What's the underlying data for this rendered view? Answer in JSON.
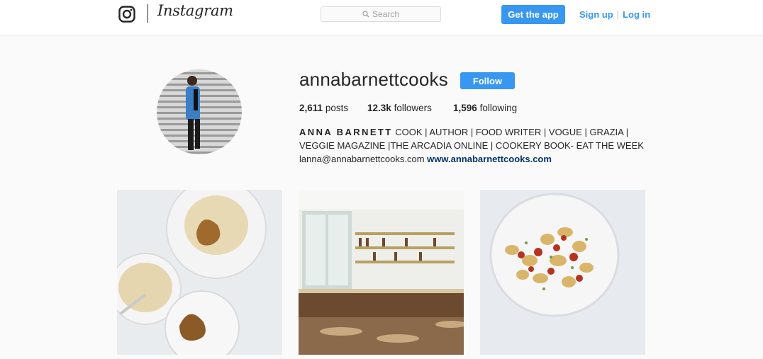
{
  "nav": {
    "wordmark": "Instagram",
    "search_placeholder": "Search",
    "get_app_label": "Get the app",
    "sign_up_label": "Sign up",
    "separator": "|",
    "log_in_label": "Log in"
  },
  "profile": {
    "username": "annabarnettcooks",
    "follow_label": "Follow",
    "stats": {
      "posts_count": "2,611",
      "posts_label": "posts",
      "followers_count": "12.3k",
      "followers_label": "followers",
      "following_count": "1,596",
      "following_label": "following"
    },
    "bio": {
      "name": "ANNA BARNETT",
      "line1_rest": " COOK | AUTHOR | FOOD WRITER | VOGUE | GRAZIA |",
      "line2": "VEGGIE MAGAZINE |THE ARCADIA ONLINE | COOKERY BOOK- EAT THE WEEK",
      "email": "lanna@annabarnettcooks.com",
      "website": "www.annabarnettcooks.com"
    }
  },
  "colors": {
    "accent": "#3897f0",
    "link_dark": "#003569",
    "background": "#fafafa"
  },
  "icons": {
    "logo": "instagram-glyph-icon",
    "search": "search-icon"
  },
  "posts": [
    {
      "subject": "rice pudding with poached pears"
    },
    {
      "subject": "restaurant bar interior"
    },
    {
      "subject": "gnocchi with tomato sauce"
    }
  ]
}
